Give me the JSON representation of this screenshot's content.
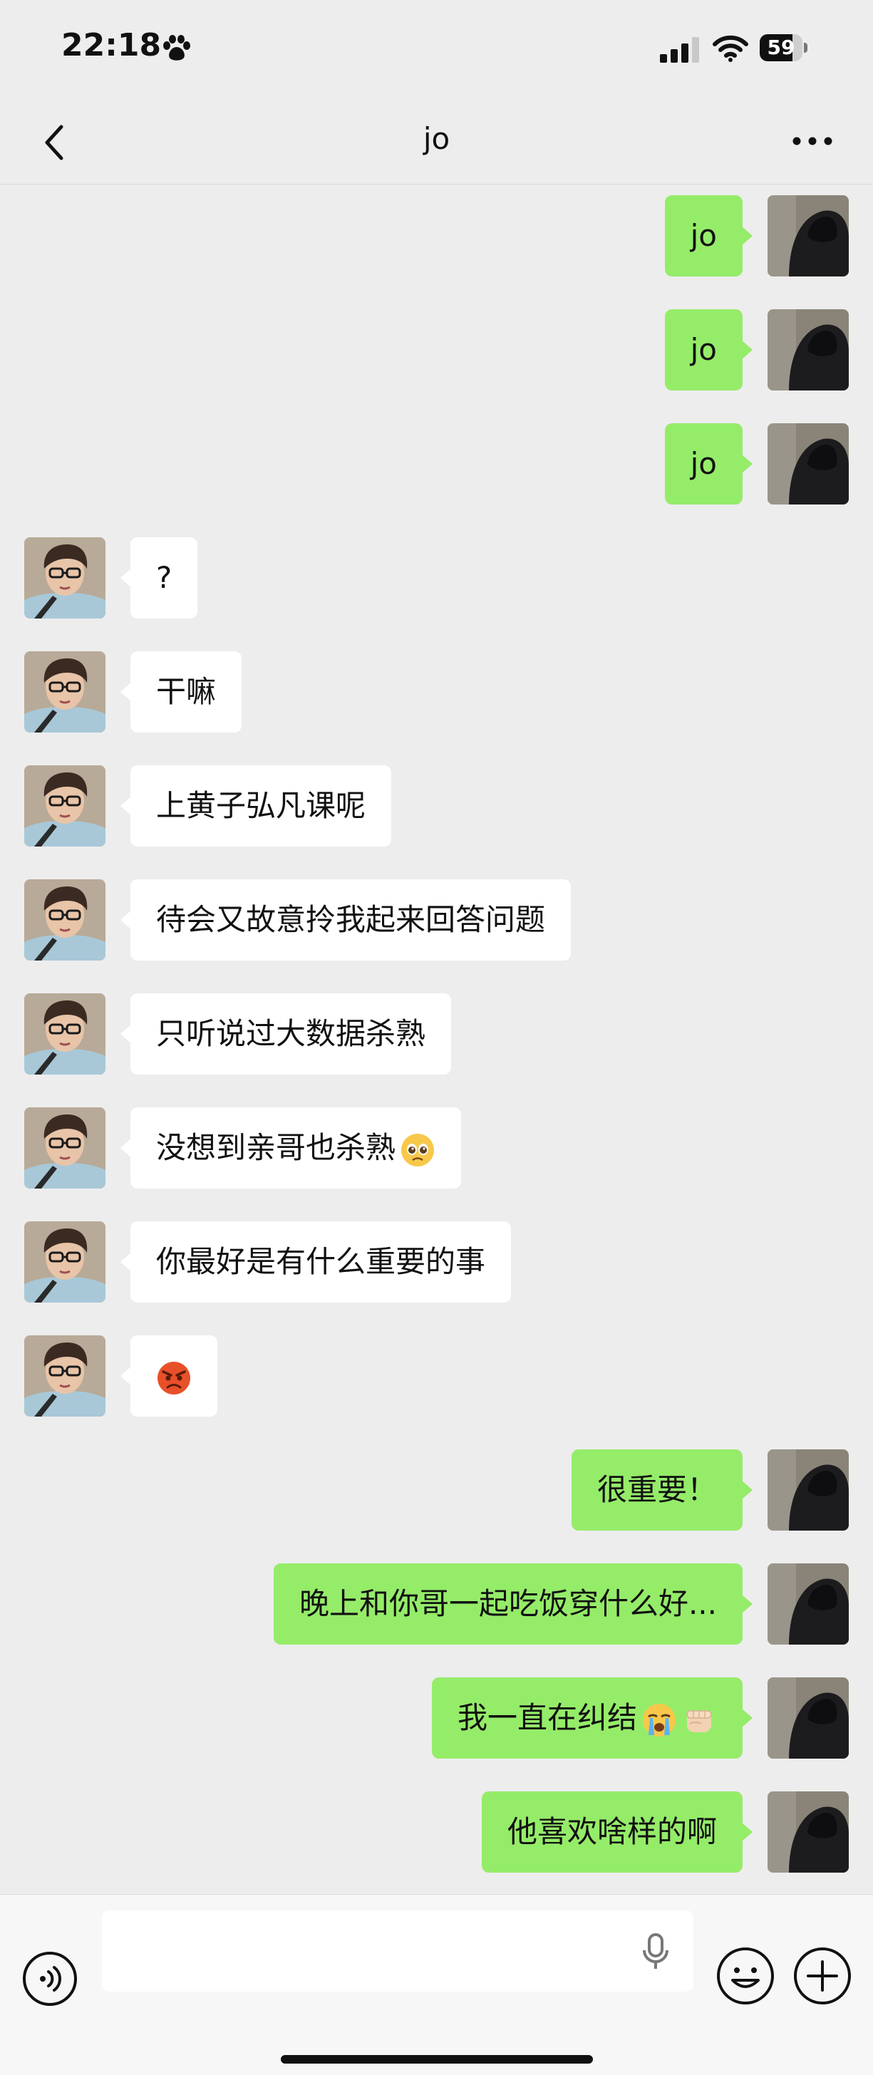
{
  "status_bar": {
    "time": "22:18",
    "battery": "59"
  },
  "nav": {
    "title": "jo"
  },
  "messages": [
    {
      "side": "out",
      "text": "jo"
    },
    {
      "side": "out",
      "text": "jo"
    },
    {
      "side": "out",
      "text": "jo"
    },
    {
      "side": "in",
      "text": "?"
    },
    {
      "side": "in",
      "text": "干嘛"
    },
    {
      "side": "in",
      "text": "上黄子弘凡课呢"
    },
    {
      "side": "in",
      "text": "待会又故意拎我起来回答问题"
    },
    {
      "side": "in",
      "text": "只听说过大数据杀熟"
    },
    {
      "side": "in",
      "text": "没想到亲哥也杀熟",
      "emoji": "pleading-face-emoji"
    },
    {
      "side": "in",
      "text": "你最好是有什么重要的事"
    },
    {
      "side": "in",
      "text": "",
      "emoji": "angry-face-emoji"
    },
    {
      "side": "out",
      "text": "很重要！"
    },
    {
      "side": "out",
      "text": "晚上和你哥一起吃饭穿什么好..."
    },
    {
      "side": "out",
      "text": "我一直在纠结",
      "emoji": "crying-face-emoji",
      "emoji2": "fist-bump-emoji"
    },
    {
      "side": "out",
      "text": "他喜欢啥样的啊"
    }
  ],
  "input": {
    "value": "",
    "placeholder": ""
  },
  "colors": {
    "outgoing_bubble": "#95ec69",
    "incoming_bubble": "#ffffff",
    "background": "#ededed"
  }
}
